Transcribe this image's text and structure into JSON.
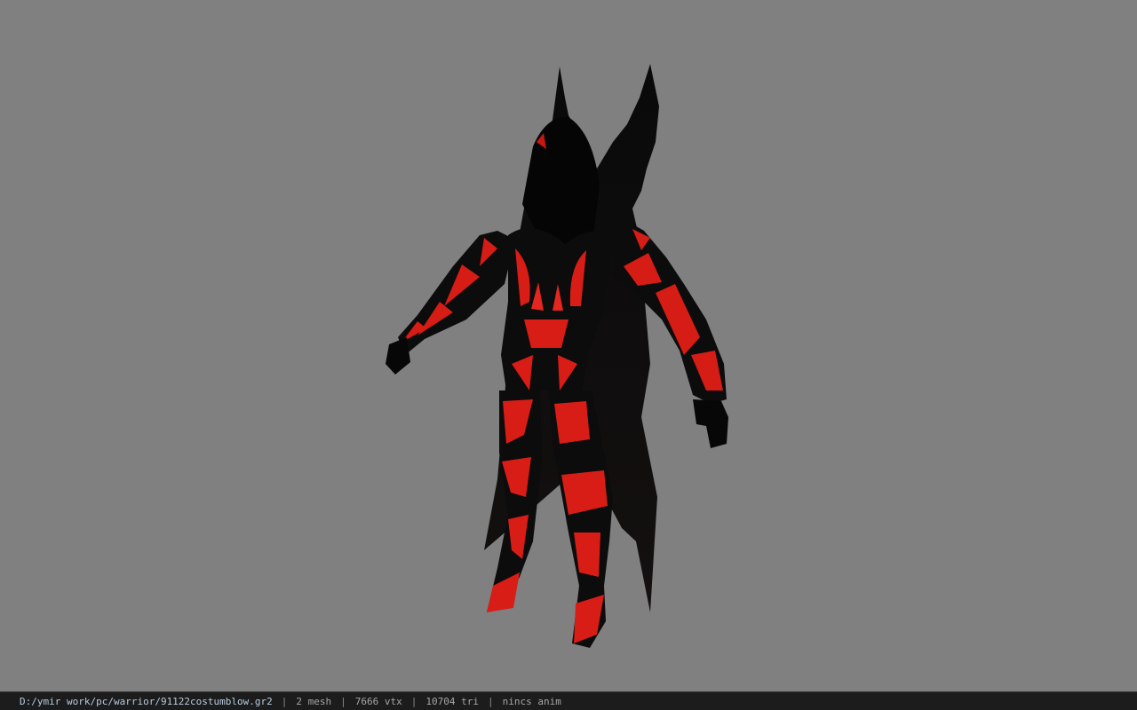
{
  "viewport": {
    "background_color": "#808080",
    "model_colors": {
      "base": "#0a0a0a",
      "glow": "#e0201a",
      "glow_dark": "#7a0a08"
    }
  },
  "statusbar": {
    "file_path": "D:/ymir work/pc/warrior/91122costumblow.gr2",
    "separator": "|",
    "mesh_info": "2 mesh",
    "vertex_info": "7666 vtx",
    "triangle_info": "10704 tri",
    "anim_info": "nincs anim"
  }
}
